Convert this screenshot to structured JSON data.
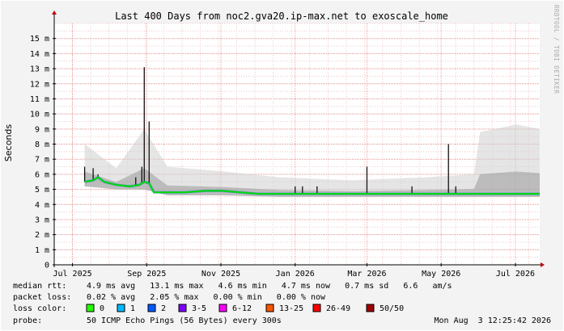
{
  "chart_data": {
    "type": "line",
    "title": "Last 400 Days from noc2.gva20.ip-max.net to exoscale_home",
    "ylabel": "Seconds",
    "watermark": "RRDTOOL / TOBI OETIKER",
    "ylim": [
      0,
      0.016
    ],
    "yticks": [
      {
        "v": 0,
        "label": "0"
      },
      {
        "v": 0.001,
        "label": "1 m"
      },
      {
        "v": 0.002,
        "label": "2 m"
      },
      {
        "v": 0.003,
        "label": "3 m"
      },
      {
        "v": 0.004,
        "label": "4 m"
      },
      {
        "v": 0.005,
        "label": "5 m"
      },
      {
        "v": 0.006,
        "label": "6 m"
      },
      {
        "v": 0.007,
        "label": "7 m"
      },
      {
        "v": 0.008,
        "label": "8 m"
      },
      {
        "v": 0.009,
        "label": "9 m"
      },
      {
        "v": 0.01,
        "label": "10 m"
      },
      {
        "v": 0.011,
        "label": "11 m"
      },
      {
        "v": 0.012,
        "label": "12 m"
      },
      {
        "v": 0.013,
        "label": "13 m"
      },
      {
        "v": 0.014,
        "label": "14 m"
      },
      {
        "v": 0.015,
        "label": "15 m"
      }
    ],
    "xlim": [
      "2025-06-30",
      "2026-08-03"
    ],
    "xticks": [
      {
        "v": "2025-07-15",
        "label": "Jul 2025"
      },
      {
        "v": "2025-09-14",
        "label": "Sep 2025"
      },
      {
        "v": "2025-11-14",
        "label": "Nov 2025"
      },
      {
        "v": "2026-01-14",
        "label": "Jan 2026"
      },
      {
        "v": "2026-03-14",
        "label": "Mar 2026"
      },
      {
        "v": "2026-05-14",
        "label": "May 2026"
      },
      {
        "v": "2026-07-14",
        "label": "Jul 2026"
      }
    ],
    "grid": true,
    "series": [
      {
        "name": "median rtt",
        "color": "#00dd00",
        "points": [
          [
            "2025-07-25",
            0.0055
          ],
          [
            "2025-08-01",
            0.0056
          ],
          [
            "2025-08-05",
            0.0058
          ],
          [
            "2025-08-10",
            0.0055
          ],
          [
            "2025-08-20",
            0.0053
          ],
          [
            "2025-08-31",
            0.0052
          ],
          [
            "2025-09-08",
            0.0053
          ],
          [
            "2025-09-12",
            0.0055
          ],
          [
            "2025-09-16",
            0.0054
          ],
          [
            "2025-09-20",
            0.0048
          ],
          [
            "2025-10-01",
            0.0048
          ],
          [
            "2025-10-15",
            0.0048
          ],
          [
            "2025-11-01",
            0.0049
          ],
          [
            "2025-11-15",
            0.0049
          ],
          [
            "2025-11-30",
            0.0048
          ],
          [
            "2025-12-15",
            0.0047
          ],
          [
            "2025-12-31",
            0.0047
          ],
          [
            "2026-01-15",
            0.0047
          ],
          [
            "2026-02-01",
            0.0047
          ],
          [
            "2026-02-15",
            0.0047
          ],
          [
            "2026-03-01",
            0.0047
          ],
          [
            "2026-03-15",
            0.0047
          ],
          [
            "2026-04-01",
            0.0047
          ],
          [
            "2026-04-15",
            0.0047
          ],
          [
            "2026-05-01",
            0.0047
          ],
          [
            "2026-05-15",
            0.0047
          ],
          [
            "2026-06-01",
            0.0047
          ],
          [
            "2026-06-15",
            0.0047
          ],
          [
            "2026-07-01",
            0.0047
          ],
          [
            "2026-07-15",
            0.0047
          ],
          [
            "2026-07-24",
            0.0047
          ],
          [
            "2026-08-03",
            0.0047
          ]
        ]
      }
    ],
    "spikes": [
      {
        "x": "2025-07-25",
        "top": 0.0065
      },
      {
        "x": "2025-08-01",
        "top": 0.0064
      },
      {
        "x": "2025-08-05",
        "top": 0.006
      },
      {
        "x": "2025-09-05",
        "top": 0.0058
      },
      {
        "x": "2025-09-10",
        "top": 0.0065
      },
      {
        "x": "2025-09-12",
        "top": 0.0131
      },
      {
        "x": "2025-09-16",
        "top": 0.0095
      },
      {
        "x": "2026-01-14",
        "top": 0.0052
      },
      {
        "x": "2026-01-20",
        "top": 0.0052
      },
      {
        "x": "2026-02-01",
        "top": 0.0052
      },
      {
        "x": "2026-03-14",
        "top": 0.0065
      },
      {
        "x": "2026-04-20",
        "top": 0.0052
      },
      {
        "x": "2026-05-20",
        "top": 0.008
      },
      {
        "x": "2026-05-26",
        "top": 0.0052
      }
    ],
    "smoke": [
      {
        "x": "2025-07-25",
        "lo": 0.0052,
        "hi": 0.008
      },
      {
        "x": "2025-08-20",
        "lo": 0.005,
        "hi": 0.0064
      },
      {
        "x": "2025-09-12",
        "lo": 0.005,
        "hi": 0.009
      },
      {
        "x": "2025-10-01",
        "lo": 0.0046,
        "hi": 0.0065
      },
      {
        "x": "2025-11-15",
        "lo": 0.0046,
        "hi": 0.0062
      },
      {
        "x": "2026-01-01",
        "lo": 0.0045,
        "hi": 0.0058
      },
      {
        "x": "2026-03-01",
        "lo": 0.0045,
        "hi": 0.0056
      },
      {
        "x": "2026-05-01",
        "lo": 0.0045,
        "hi": 0.0058
      },
      {
        "x": "2026-06-10",
        "lo": 0.0045,
        "hi": 0.006
      },
      {
        "x": "2026-06-15",
        "lo": 0.0045,
        "hi": 0.0088
      },
      {
        "x": "2026-07-15",
        "lo": 0.0045,
        "hi": 0.0093
      },
      {
        "x": "2026-08-03",
        "lo": 0.0045,
        "hi": 0.009
      }
    ]
  },
  "legend": {
    "median_label": "median rtt:",
    "median_values": "4.9 ms avg   13.1 ms max   4.6 ms min   4.7 ms now   0.7 ms sd   6.6   am/s",
    "loss_label": "packet loss:",
    "loss_values": "0.02 % avg   2.05 % max   0.00 % min   0.00 % now",
    "color_label": "loss color:",
    "colors": [
      {
        "label": "0",
        "color": "#26ff00"
      },
      {
        "label": "1",
        "color": "#00b8ff"
      },
      {
        "label": "2",
        "color": "#0059ff"
      },
      {
        "label": "3-5",
        "color": "#7e00ff"
      },
      {
        "label": "6-12",
        "color": "#ff00ff"
      },
      {
        "label": "13-25",
        "color": "#ff5500"
      },
      {
        "label": "26-49",
        "color": "#ff0000"
      },
      {
        "label": "50/50",
        "color": "#a10000"
      }
    ],
    "probe_label": "probe:",
    "probe_values": "50 ICMP Echo Pings (56 Bytes) every 300s",
    "timestamp": "Mon Aug  3 12:25:42 2026"
  }
}
